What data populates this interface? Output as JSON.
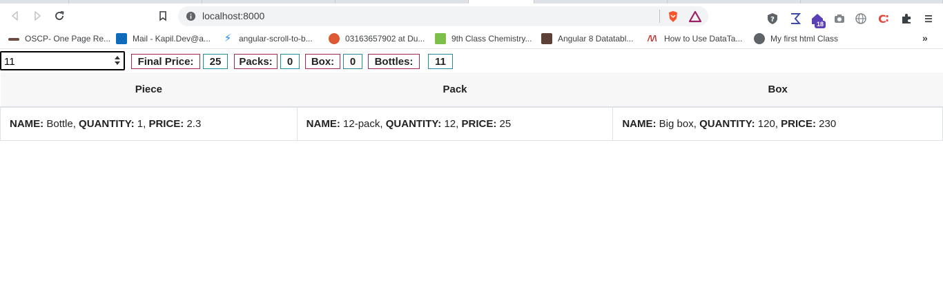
{
  "browser": {
    "url": "localhost:8000",
    "extension_badge": "18",
    "bookmarks": [
      {
        "label": "OSCP- One Page Re...",
        "icon": "oscp-icon",
        "color": "#6d4c41"
      },
      {
        "label": "Mail - Kapil.Dev@a...",
        "icon": "outlook-icon",
        "color": "#0f6cbd"
      },
      {
        "label": "angular-scroll-to-b...",
        "icon": "stackblitz-icon",
        "color": "#1389fd"
      },
      {
        "label": "03163657902 at Du...",
        "icon": "duckduckgo-icon",
        "color": "#de5833"
      },
      {
        "label": "9th Class Chemistry...",
        "icon": "chemistry-icon",
        "color": "#7cc04b"
      },
      {
        "label": "Angular 8 Datatabl...",
        "icon": "avatar-icon",
        "color": "#5d4037"
      },
      {
        "label": "How to Use DataTa...",
        "icon": "datatables-icon",
        "color": "#c62828"
      },
      {
        "label": "My first html Class",
        "icon": "globe-icon",
        "color": "#5f6368"
      }
    ]
  },
  "controls": {
    "quantity_value": "11",
    "final_price_label": "Final Price:",
    "final_price_value": "25",
    "packs_label": "Packs:",
    "packs_value": "0",
    "box_label": "Box:",
    "box_value": "0",
    "bottles_label": "Bottles:",
    "bottles_value": "11"
  },
  "table": {
    "headers": [
      "Piece",
      "Pack",
      "Box"
    ],
    "field_labels": {
      "name": "NAME:",
      "quantity": "QUANTITY:",
      "price": "PRICE:"
    },
    "rows": [
      {
        "name": "Bottle",
        "quantity": "1",
        "price": "2.3"
      },
      {
        "name": "12-pack",
        "quantity": "12",
        "price": "25"
      },
      {
        "name": "Big box",
        "quantity": "120",
        "price": "230"
      }
    ]
  }
}
